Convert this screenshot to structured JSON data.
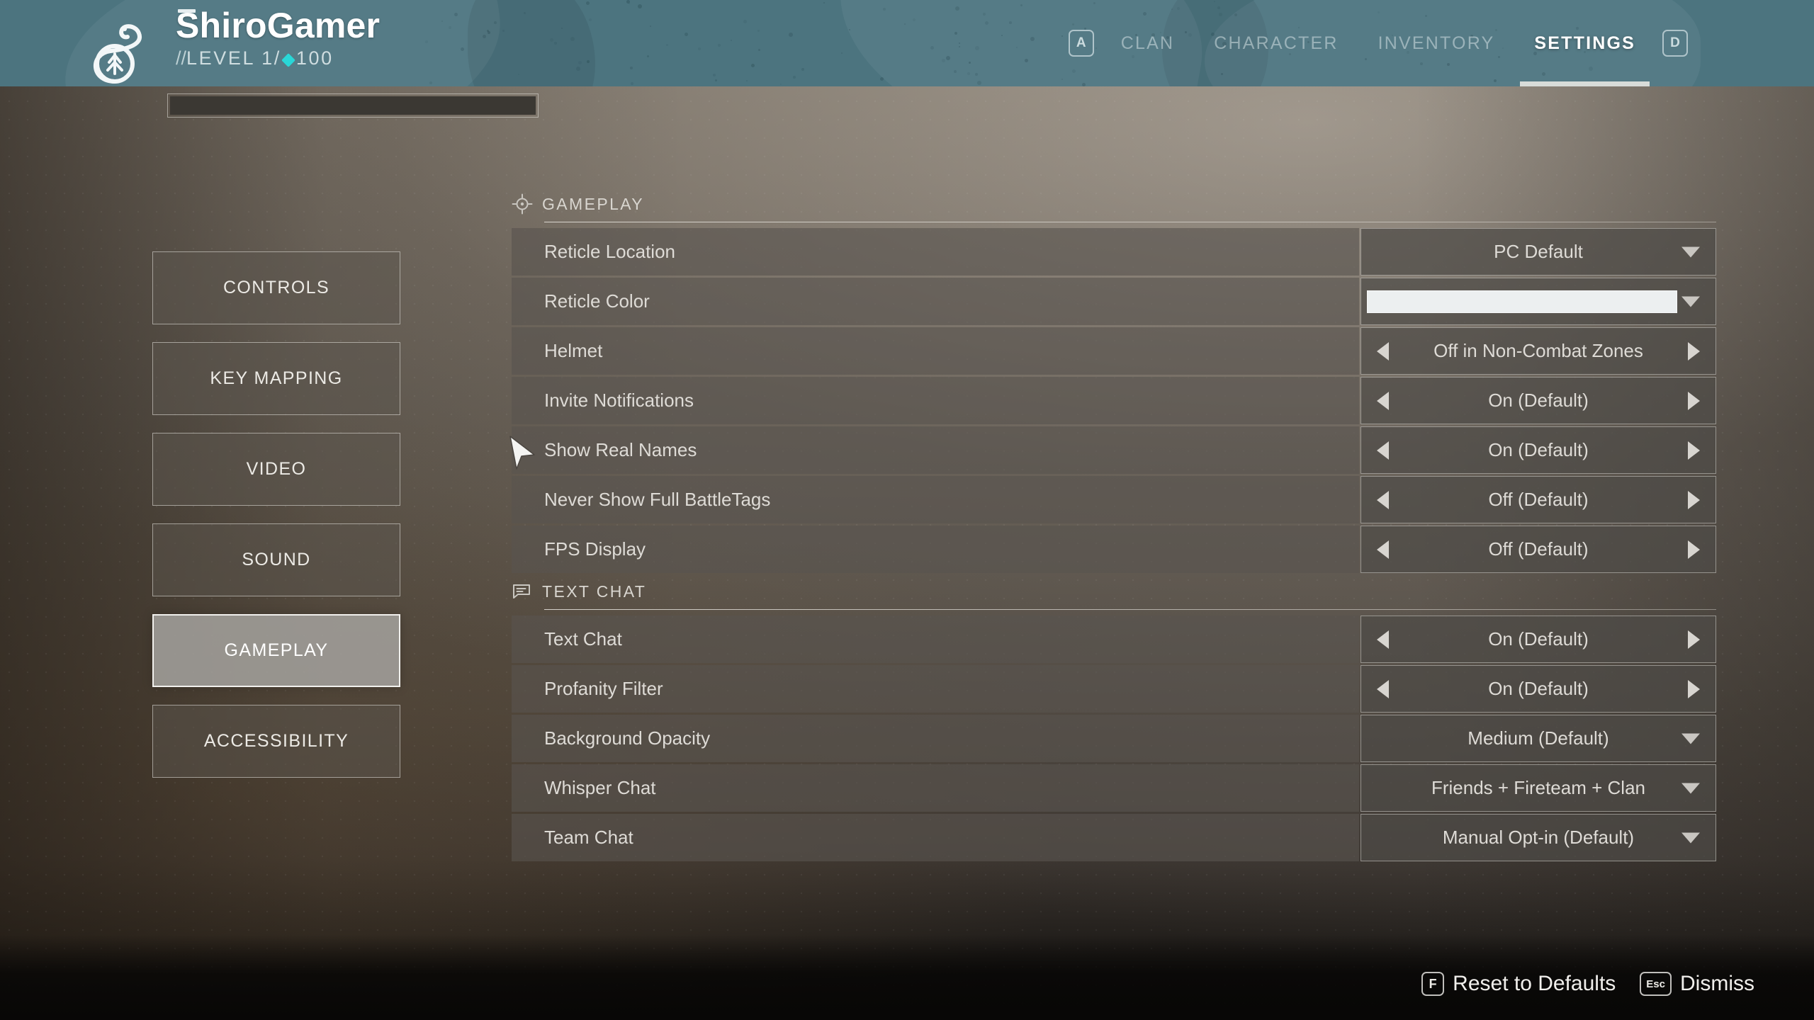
{
  "header": {
    "emblem_icon": "snake-coiled-tree-emblem",
    "player_name": "ShiroGamer",
    "level_prefix": "//",
    "level_text": "LEVEL 1/",
    "light_level": "100",
    "nav": {
      "left_key": "A",
      "right_key": "D",
      "items": [
        {
          "label": "CLAN",
          "active": false
        },
        {
          "label": "CHARACTER",
          "active": false
        },
        {
          "label": "INVENTORY",
          "active": false
        },
        {
          "label": "SETTINGS",
          "active": true
        }
      ]
    },
    "accent_color": "#4c747f",
    "gem_color": "#29d7d7"
  },
  "sidebar": {
    "items": [
      {
        "label": "CONTROLS",
        "active": false
      },
      {
        "label": "KEY MAPPING",
        "active": false
      },
      {
        "label": "VIDEO",
        "active": false
      },
      {
        "label": "SOUND",
        "active": false
      },
      {
        "label": "GAMEPLAY",
        "active": true
      },
      {
        "label": "ACCESSIBILITY",
        "active": false
      }
    ]
  },
  "sections": [
    {
      "title": "GAMEPLAY",
      "icon": "reticle-icon",
      "rows": [
        {
          "label": "Reticle Location",
          "type": "dropdown",
          "value": "PC Default"
        },
        {
          "label": "Reticle Color",
          "type": "color",
          "value": "#eceff0"
        },
        {
          "label": "Helmet",
          "type": "stepper",
          "value": "Off in Non-Combat Zones"
        },
        {
          "label": "Invite Notifications",
          "type": "stepper",
          "value": "On (Default)"
        },
        {
          "label": "Show Real Names",
          "type": "stepper",
          "value": "On (Default)"
        },
        {
          "label": "Never Show Full BattleTags",
          "type": "stepper",
          "value": "Off (Default)"
        },
        {
          "label": "FPS Display",
          "type": "stepper",
          "value": "Off (Default)"
        }
      ]
    },
    {
      "title": "TEXT CHAT",
      "icon": "chat-bubble-icon",
      "rows": [
        {
          "label": "Text Chat",
          "type": "stepper",
          "value": "On (Default)"
        },
        {
          "label": "Profanity Filter",
          "type": "stepper",
          "value": "On (Default)"
        },
        {
          "label": "Background Opacity",
          "type": "dropdown",
          "value": "Medium (Default)"
        },
        {
          "label": "Whisper Chat",
          "type": "dropdown",
          "value": "Friends + Fireteam + Clan"
        },
        {
          "label": "Team Chat",
          "type": "dropdown",
          "value": "Manual Opt-in (Default)"
        }
      ]
    }
  ],
  "footer": {
    "actions": [
      {
        "key": "F",
        "label": "Reset to Defaults"
      },
      {
        "key": "Esc",
        "label": "Dismiss"
      }
    ]
  }
}
